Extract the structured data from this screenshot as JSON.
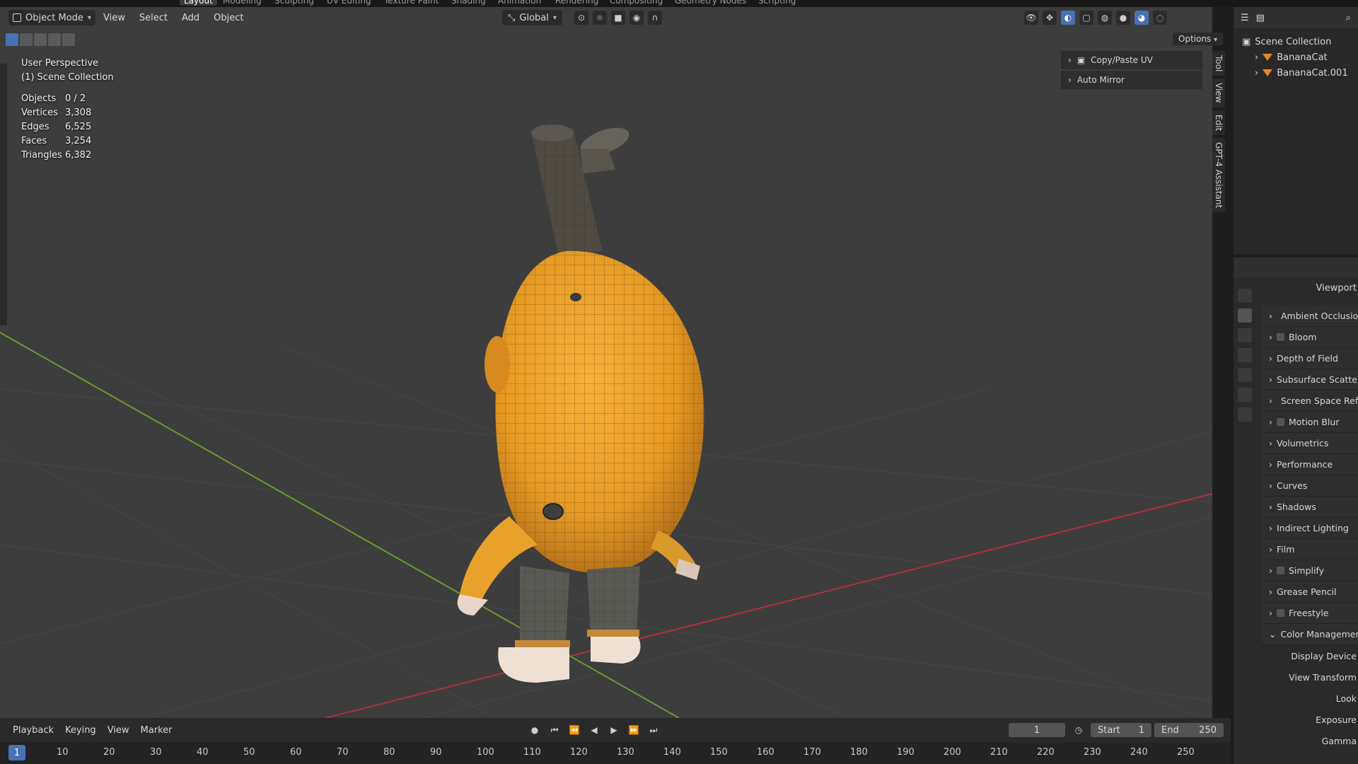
{
  "workspaces": [
    "Layout",
    "Modeling",
    "Sculpting",
    "UV Editing",
    "Texture Paint",
    "Shading",
    "Animation",
    "Rendering",
    "Compositing",
    "Geometry Nodes",
    "Scripting"
  ],
  "header": {
    "mode": "Object Mode",
    "menus": [
      "View",
      "Select",
      "Add",
      "Object"
    ],
    "orientation": "Global",
    "options": "Options"
  },
  "overlay": {
    "perspective": "User Perspective",
    "collection": "(1) Scene Collection",
    "stats": [
      {
        "label": "Objects",
        "value": "0 / 2"
      },
      {
        "label": "Vertices",
        "value": "3,308"
      },
      {
        "label": "Edges",
        "value": "6,525"
      },
      {
        "label": "Faces",
        "value": "3,254"
      },
      {
        "label": "Triangles",
        "value": "6,382"
      }
    ]
  },
  "sidepanel": [
    "Copy/Paste UV",
    "Auto Mirror"
  ],
  "ntabs": [
    "Tool",
    "View",
    "Edit",
    "GPT-4 Assistant"
  ],
  "outliner": {
    "root": "Scene Collection",
    "items": [
      "BananaCat",
      "BananaCat.001"
    ]
  },
  "properties": {
    "title": "Viewport",
    "sections": [
      {
        "label": "Ambient Occlusion",
        "checkbox": true
      },
      {
        "label": "Bloom",
        "checkbox": true
      },
      {
        "label": "Depth of Field",
        "checkbox": false
      },
      {
        "label": "Subsurface Scattering",
        "checkbox": false
      },
      {
        "label": "Screen Space Reflections",
        "checkbox": true
      },
      {
        "label": "Motion Blur",
        "checkbox": true
      },
      {
        "label": "Volumetrics",
        "checkbox": false
      },
      {
        "label": "Performance",
        "checkbox": false
      },
      {
        "label": "Curves",
        "checkbox": false
      },
      {
        "label": "Shadows",
        "checkbox": false
      },
      {
        "label": "Indirect Lighting",
        "checkbox": false
      },
      {
        "label": "Film",
        "checkbox": false
      },
      {
        "label": "Simplify",
        "checkbox": true
      },
      {
        "label": "Grease Pencil",
        "checkbox": false
      },
      {
        "label": "Freestyle",
        "checkbox": true
      },
      {
        "label": "Color Management",
        "checkbox": false
      }
    ],
    "color_management": [
      "Display Device",
      "View Transform",
      "Look",
      "Exposure",
      "Gamma"
    ]
  },
  "timeline": {
    "menus": [
      "Playback",
      "Keying",
      "View",
      "Marker"
    ],
    "current_frame": "1",
    "start_label": "Start",
    "start": "1",
    "end_label": "End",
    "end": "250",
    "ticks": [
      "1",
      "10",
      "20",
      "30",
      "40",
      "50",
      "60",
      "70",
      "80",
      "90",
      "100",
      "110",
      "120",
      "130",
      "140",
      "150",
      "160",
      "170",
      "180",
      "190",
      "200",
      "210",
      "220",
      "230",
      "240",
      "250"
    ]
  },
  "colors": {
    "accent": "#4772b3",
    "object": "#e8862a",
    "x_axis": "#b0303a",
    "y_axis": "#6a9a2a"
  }
}
